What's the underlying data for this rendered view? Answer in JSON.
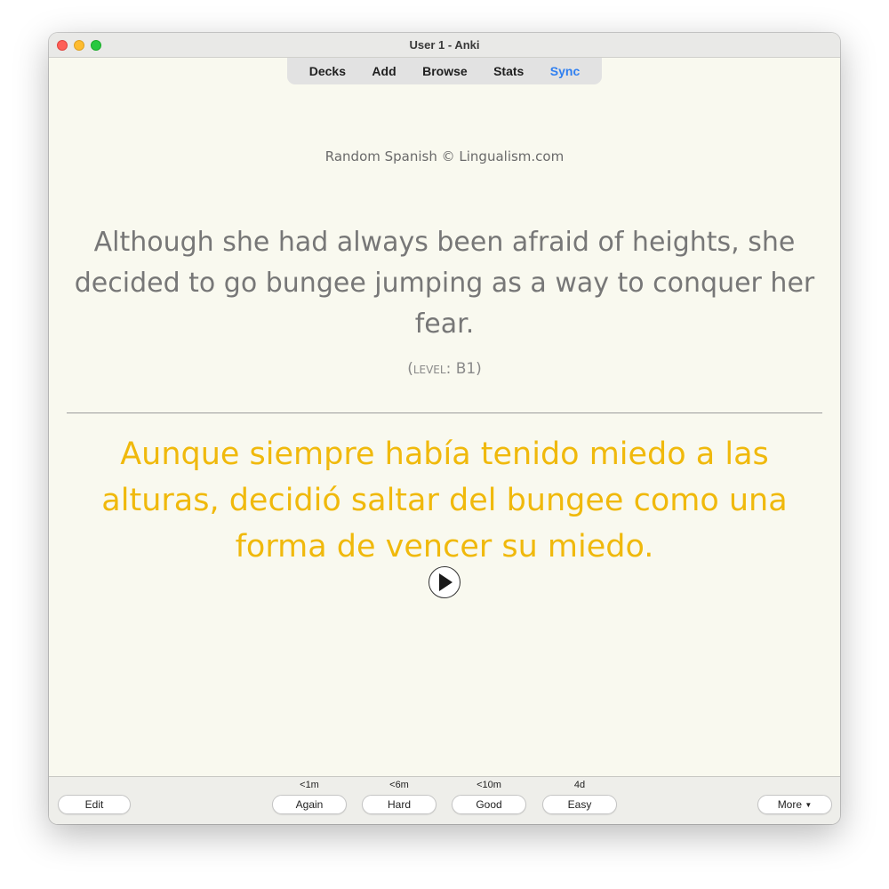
{
  "window": {
    "title": "User 1 - Anki"
  },
  "toolbar": {
    "items": [
      "Decks",
      "Add",
      "Browse",
      "Stats",
      "Sync"
    ]
  },
  "card": {
    "deck_note": "Random Spanish © Lingualism.com",
    "front_text": "Although she had always been afraid of heights, she decided to go bungee jumping as a way to conquer her fear.",
    "level": "(level: B1)",
    "back_text": "Aunque siempre había tenido miedo a las alturas, decidió saltar del bungee como una forma de vencer su miedo.",
    "play_icon": "play-icon"
  },
  "bottom": {
    "edit_label": "Edit",
    "answers": [
      {
        "interval": "<1m",
        "label": "Again"
      },
      {
        "interval": "<6m",
        "label": "Hard"
      },
      {
        "interval": "<10m",
        "label": "Good"
      },
      {
        "interval": "4d",
        "label": "Easy"
      }
    ],
    "more_label": "More",
    "more_icon": "chevron-down-icon"
  },
  "colors": {
    "background": "#f9f9ef",
    "front_text": "#777777",
    "back_text": "#f0b90c",
    "sync_accent": "#2f7ff0"
  }
}
